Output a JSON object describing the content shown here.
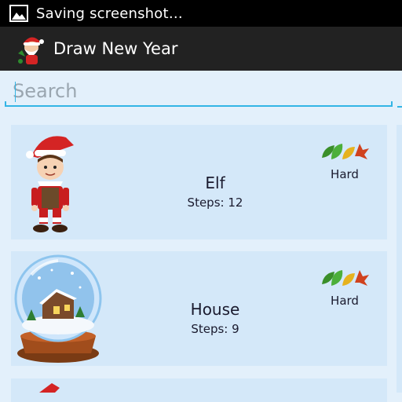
{
  "status_bar": {
    "text": "Saving screenshot…",
    "icon": "image-icon"
  },
  "action_bar": {
    "title": "Draw New Year",
    "icon": "santa-app-icon"
  },
  "search": {
    "placeholder": "Search",
    "value": ""
  },
  "items": [
    {
      "title": "Elf",
      "steps": "Steps: 12",
      "difficulty": "Hard",
      "image": "elf-image",
      "difficulty_icon": "leaves-icon"
    },
    {
      "title": "House",
      "steps": "Steps: 9",
      "difficulty": "Hard",
      "image": "snow-globe-house-image",
      "difficulty_icon": "leaves-icon"
    }
  ],
  "colors": {
    "background": "#e3f0fb",
    "card": "#d4e8f9",
    "accent": "#33b5e5",
    "action_bar": "#222222",
    "status_bar": "#000000"
  }
}
